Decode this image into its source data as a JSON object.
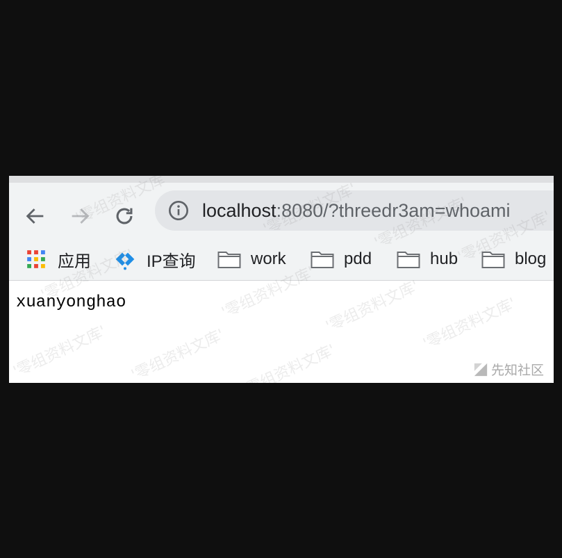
{
  "browser": {
    "address_bar": {
      "host": "localhost",
      "rest": ":8080/?threedr3am=whoami"
    },
    "bookmarks": [
      {
        "label": "应用",
        "icon": "apps-grid-icon"
      },
      {
        "label": "IP查询",
        "icon": "ip-lookup-icon"
      },
      {
        "label": "work",
        "icon": "folder-icon"
      },
      {
        "label": "pdd",
        "icon": "folder-icon"
      },
      {
        "label": "hub",
        "icon": "folder-icon"
      },
      {
        "label": "blog",
        "icon": "folder-icon"
      }
    ]
  },
  "page": {
    "output": "xuanyonghao"
  },
  "watermark": {
    "text": "'零组资料文库'",
    "corner": "先知社区"
  },
  "colors": {
    "toolbar": "#f1f3f4",
    "omnibox": "#e3e5e8",
    "ip_icon": "#1f8ee6"
  }
}
